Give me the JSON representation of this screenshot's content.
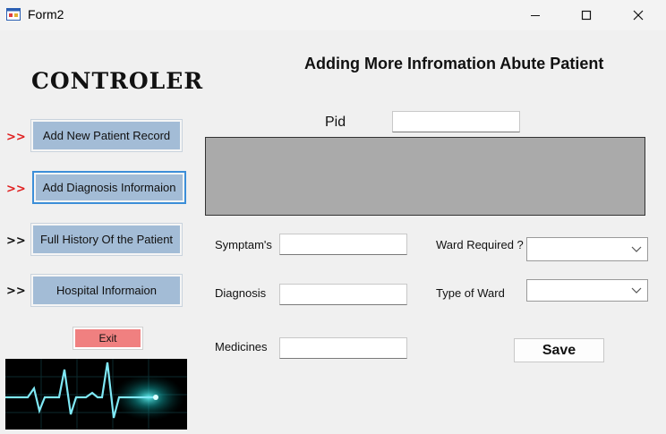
{
  "window": {
    "title": "Form2"
  },
  "sidebar": {
    "heading": "CONTROLER",
    "items": [
      {
        "arrow": ">>",
        "label": "Add New Patient Record"
      },
      {
        "arrow": ">>",
        "label": "Add Diagnosis Informaion"
      },
      {
        "arrow": ">>",
        "label": "Full History Of the Patient"
      },
      {
        "arrow": ">>",
        "label": "Hospital Informaion"
      }
    ],
    "exit_label": "Exit"
  },
  "main": {
    "heading": "Adding More Infromation Abute Patient",
    "pid_label": "Pid",
    "pid_value": "",
    "symptoms_label": "Symptam's",
    "diagnosis_label": "Diagnosis",
    "medicines_label": "Medicines",
    "ward_required_label": "Ward Required ?",
    "type_of_ward_label": "Type of Ward",
    "ward_required_value": "",
    "type_of_ward_value": "",
    "save_label": "Save"
  },
  "colors": {
    "nav_button": "#a3bcd6",
    "exit_button": "#f08080",
    "panel": "#aaaaaa",
    "arrow_active": "#e02020"
  }
}
